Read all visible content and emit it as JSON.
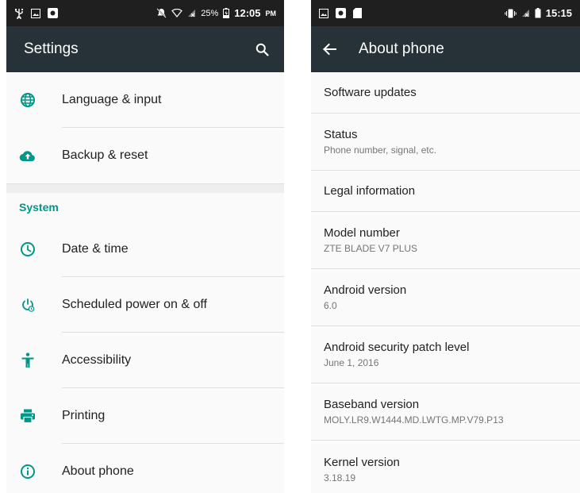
{
  "colors": {
    "accent": "#009688",
    "appbar": "#263238",
    "statusbar": "#1f1f1f"
  },
  "left": {
    "status": {
      "battery": "25%",
      "time": "12:05",
      "ampm": "PM"
    },
    "title": "Settings",
    "rows_top": [
      {
        "icon": "globe-icon",
        "label": "Language & input"
      },
      {
        "icon": "cloud-upload-icon",
        "label": "Backup & reset"
      }
    ],
    "section": "System",
    "rows_system": [
      {
        "icon": "clock-icon",
        "label": "Date & time"
      },
      {
        "icon": "scheduled-power-icon",
        "label": "Scheduled power on & off"
      },
      {
        "icon": "accessibility-icon",
        "label": "Accessibility"
      },
      {
        "icon": "printer-icon",
        "label": "Printing"
      },
      {
        "icon": "info-icon",
        "label": "About phone"
      }
    ]
  },
  "right": {
    "status": {
      "time": "15:15"
    },
    "title": "About phone",
    "items": [
      {
        "title": "Software updates"
      },
      {
        "title": "Status",
        "subtitle": "Phone number, signal, etc."
      },
      {
        "title": "Legal information"
      },
      {
        "title": "Model number",
        "subtitle": "ZTE BLADE V7 PLUS"
      },
      {
        "title": "Android version",
        "subtitle": "6.0"
      },
      {
        "title": "Android security patch level",
        "subtitle": "June 1, 2016"
      },
      {
        "title": "Baseband version",
        "subtitle": "MOLY.LR9.W1444.MD.LWTG.MP.V79.P13"
      },
      {
        "title": "Kernel version",
        "subtitle": "3.18.19"
      }
    ]
  }
}
